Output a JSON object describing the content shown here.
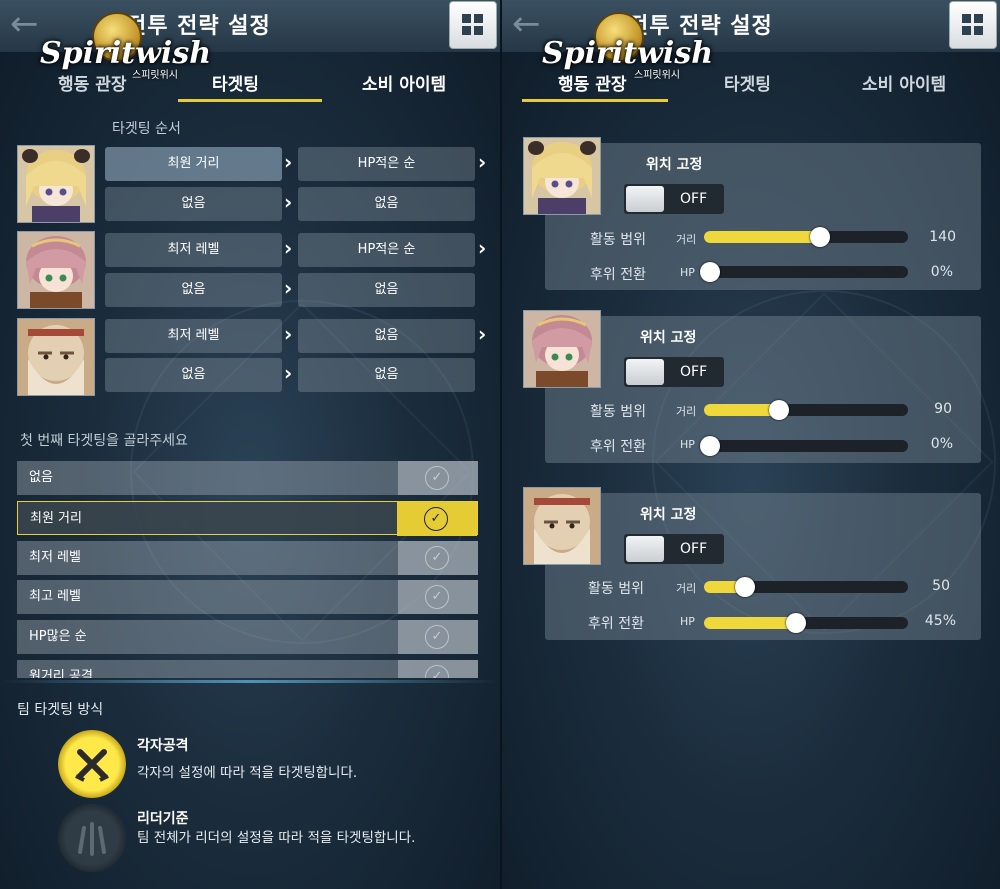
{
  "header": {
    "title": "전투 전략 설정",
    "logo_text": "Spiritwish",
    "logo_sub": "스피릿위시"
  },
  "tabs": [
    "행동 관장",
    "타겟팅",
    "소비 아이템"
  ],
  "left": {
    "targeting_order_label": "타겟팅 순서",
    "heroes": [
      {
        "rows": [
          [
            "최원 거리",
            "HP적은 순"
          ],
          [
            "없음",
            "없음"
          ]
        ]
      },
      {
        "rows": [
          [
            "최저 레벨",
            "HP적은 순"
          ],
          [
            "없음",
            "없음"
          ]
        ]
      },
      {
        "rows": [
          [
            "최저 레벨",
            "없음"
          ],
          [
            "없음",
            "없음"
          ]
        ]
      }
    ],
    "choose_label": "첫 번째 타겟팅을 골라주세요",
    "options": [
      "없음",
      "최원 거리",
      "최저 레벨",
      "최고 레벨",
      "HP많은 순",
      "원거리 공격"
    ],
    "selected_option": 1,
    "team_label": "팀 타겟팅 방식",
    "team_options": [
      {
        "title": "각자공격",
        "desc": "각자의 설정에 따라 적을 타겟팅합니다."
      },
      {
        "title": "리더기준",
        "desc": "팀 전체가 리더의 설정을 따라 적을 타겟팅합니다."
      }
    ]
  },
  "right": {
    "cards": [
      {
        "fix_label": "위치 고정",
        "toggle": "OFF",
        "range_label": "활동 범위",
        "range_tag": "거리",
        "range_value": "140",
        "range_fraction": 0.57,
        "retreat_label": "후위 전환",
        "retreat_tag": "HP",
        "retreat_value": "0%",
        "retreat_fraction": 0.0
      },
      {
        "fix_label": "위치 고정",
        "toggle": "OFF",
        "range_label": "활동 범위",
        "range_tag": "거리",
        "range_value": "90",
        "range_fraction": 0.37,
        "retreat_label": "후위 전환",
        "retreat_tag": "HP",
        "retreat_value": "0%",
        "retreat_fraction": 0.0
      },
      {
        "fix_label": "위치 고정",
        "toggle": "OFF",
        "range_label": "활동 범위",
        "range_tag": "거리",
        "range_value": "50",
        "range_fraction": 0.2,
        "retreat_label": "후위 전환",
        "retreat_tag": "HP",
        "retreat_value": "45%",
        "retreat_fraction": 0.45
      }
    ]
  },
  "colors": {
    "accent": "#e8cf3c",
    "background": "#1b2d3d"
  }
}
